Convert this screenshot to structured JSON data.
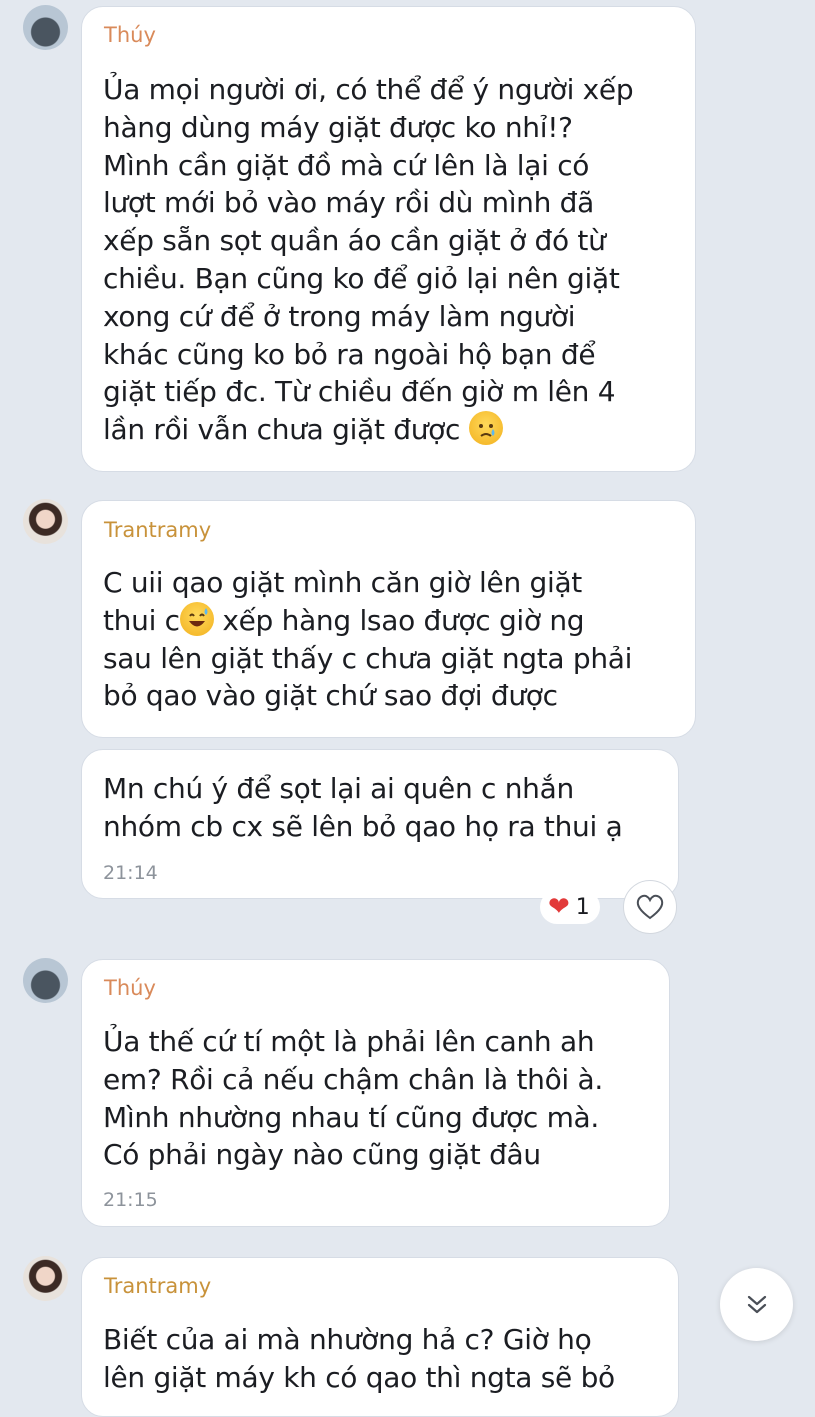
{
  "messages": [
    {
      "sender": "Thúy",
      "lines": [
        "Ủa mọi người ơi, có thể để ý người xếp",
        "hàng dùng máy giặt được ko nhỉ!?",
        "Mình cần giặt đồ mà cứ lên là lại có",
        "lượt mới bỏ vào máy rồi dù mình đã",
        "xếp sẵn sọt quần áo cần giặt ở đó từ",
        "chiều. Bạn cũng ko để giỏ lại nên giặt",
        "xong cứ để ở trong máy làm người",
        "khác cũng ko bỏ ra ngoài hộ bạn để",
        "giặt tiếp đc. Từ chiều đến giờ m lên 4",
        "lần rồi vẫn chưa giặt được"
      ],
      "emoji": "crying-face-emoji"
    },
    {
      "sender": "Trantramy",
      "lines": [
        "C uii qao giặt mình căn giờ lên giặt",
        "thui c",
        "sau lên giặt thấy c chưa giặt ngta phải",
        "bỏ qao vào giặt chứ sao đợi được"
      ],
      "line2_after_emoji": " xếp hàng lsao được giờ ng",
      "emoji": "grinning-sweat-emoji"
    },
    {
      "lines": [
        "Mn chú ý để sọt lại ai quên c nhắn",
        "nhóm cb cx sẽ lên bỏ qao họ ra thui ạ"
      ],
      "time": "21:14",
      "reaction_count": "1"
    },
    {
      "sender": "Thúy",
      "lines": [
        "Ủa thế cứ tí một là phải lên canh ah",
        "em? Rồi cả nếu chậm chân là thôi à.",
        "Mình nhường nhau tí cũng được mà.",
        "Có phải ngày nào cũng giặt đâu"
      ],
      "time": "21:15"
    },
    {
      "sender": "Trantramy",
      "lines": [
        "Biết của ai mà nhường hả c? Giờ họ",
        "lên giặt máy kh có qao thì ngta sẽ bỏ"
      ]
    }
  ],
  "colors": {
    "background": "#e3e8ef",
    "sender_thuy": "#d98a5a",
    "sender_tram": "#c8923a",
    "reaction_heart": "#e23a3a"
  }
}
